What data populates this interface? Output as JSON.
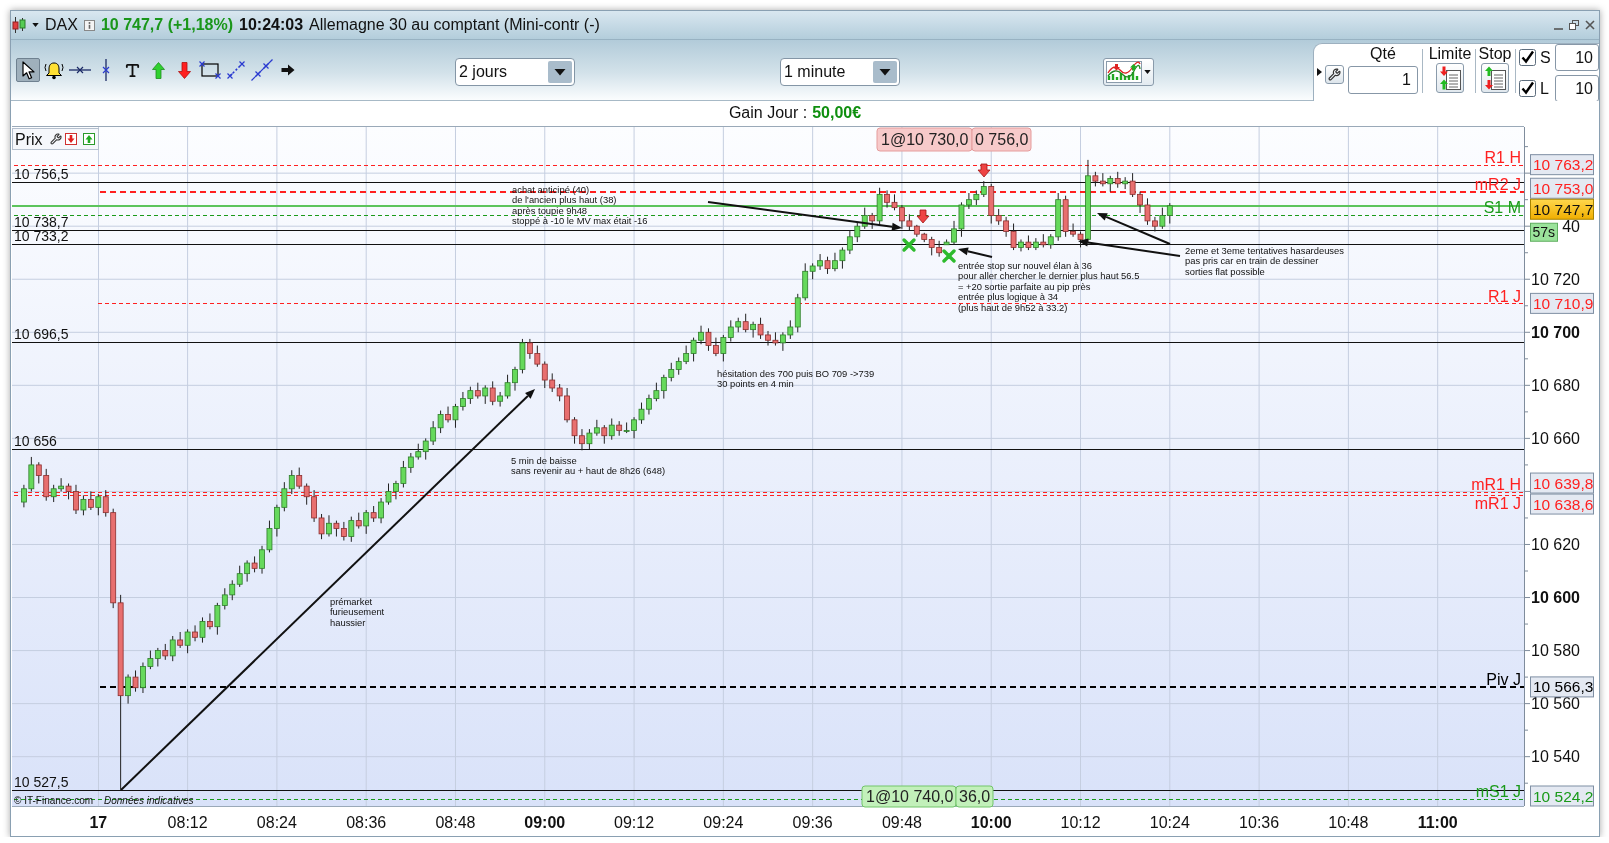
{
  "window": {
    "symbol": "DAX",
    "quote": "10 747,7 (+1,18%)",
    "time": "10:24:03",
    "instrument": "Allemagne 30 au comptant (Mini-contr (-)"
  },
  "toolbar": {
    "tools": [
      {
        "kind": "pointer",
        "selected": true
      },
      {
        "kind": "alert",
        "selected": false
      },
      {
        "kind": "horizontal-line",
        "selected": false
      },
      {
        "kind": "vertical-line",
        "selected": false
      },
      {
        "kind": "text",
        "selected": false
      },
      {
        "kind": "buy-arrow",
        "selected": false
      },
      {
        "kind": "sell-arrow",
        "selected": false
      },
      {
        "kind": "rectangle",
        "selected": false
      },
      {
        "kind": "dotted-segment",
        "selected": false
      },
      {
        "kind": "trend-line",
        "selected": false
      },
      {
        "kind": "arrow",
        "selected": false
      }
    ],
    "period": "2 jours",
    "interval": "1 minute"
  },
  "order_panel": {
    "quantity_label": "Qté",
    "quantity": "1",
    "limit_label": "Limite",
    "stop_label": "Stop",
    "offsets": [
      {
        "label": "S",
        "checked": true,
        "value": "10"
      },
      {
        "label": "L",
        "checked": true,
        "value": "10"
      }
    ]
  },
  "gain": {
    "label": "Gain Jour :",
    "value": "50,00€"
  },
  "chart": {
    "legend": "Prix",
    "trades": [
      {
        "kind": "loss",
        "entry": "1@10 730,0",
        "exit": "0 756,0"
      },
      {
        "kind": "profit",
        "entry": "1@10 740,0",
        "exit": "36,0"
      }
    ],
    "notes": [
      {
        "lines": [
          "achat anticipé (40)",
          "de l'ancien plus haut (38)",
          "après toupie 9h48",
          "stoppé à -10 le MV max était -16"
        ]
      },
      {
        "lines": [
          "entrée stop sur nouvel élan à 36",
          "pour aller chercher le dernier plus haut 56.5",
          "= +20 sortie parfaite au pip près",
          "entrée plus logique à 34",
          "(plus haut de 9h52 à 33.2)"
        ]
      },
      {
        "lines": [
          "2eme et 3eme tentatives hasardeuses",
          "pas pris car en train de dessiner",
          "sorties flat possible"
        ]
      },
      {
        "lines": [
          "hésitation des 700 puis BO 709 ->739",
          "30 points en 4 min"
        ]
      },
      {
        "lines": [
          "5 min de baisse",
          "sans revenir au + haut de 8h26 (648)"
        ]
      },
      {
        "lines": [
          "prémarket",
          "furieusement",
          "haussier"
        ]
      }
    ],
    "markers": [
      {
        "kind": "down-arrow"
      },
      {
        "kind": "down-arrow"
      },
      {
        "kind": "cross"
      },
      {
        "kind": "cross"
      }
    ],
    "chart_data": {
      "type": "candlestick",
      "x": [
        470,
        471,
        472,
        473,
        474,
        475,
        476,
        477,
        478,
        479,
        480,
        481,
        482,
        483,
        484,
        485,
        486,
        487,
        488,
        489,
        490,
        491,
        492,
        493,
        494,
        495,
        496,
        497,
        498,
        499,
        500,
        501,
        502,
        503,
        504,
        505,
        506,
        507,
        508,
        509,
        510,
        511,
        512,
        513,
        514,
        515,
        516,
        517,
        518,
        519,
        520,
        521,
        522,
        523,
        524,
        525,
        526,
        527,
        528,
        529,
        530,
        531,
        532,
        533,
        534,
        535,
        536,
        537,
        538,
        539,
        540,
        541,
        542,
        543,
        544,
        545,
        546,
        547,
        548,
        549,
        550,
        551,
        552,
        553,
        554,
        555,
        556,
        557,
        558,
        559,
        560,
        561,
        562,
        563,
        564,
        565,
        566,
        567,
        568,
        569,
        570,
        571,
        572,
        573,
        574,
        575,
        576,
        577,
        578,
        579,
        580,
        581,
        582,
        583,
        584,
        585,
        586,
        587,
        588,
        589,
        590,
        591,
        592,
        593,
        594,
        595,
        596,
        597,
        598,
        599,
        600,
        601,
        602,
        603,
        604,
        605,
        606,
        607,
        608,
        609,
        610,
        611,
        612,
        613,
        614,
        615,
        616,
        617,
        618,
        619,
        620,
        621,
        622,
        623,
        624
      ],
      "ohlc": [
        [
          10636,
          10642.5,
          10634,
          10641
        ],
        [
          10641,
          10653,
          10640,
          10650
        ],
        [
          10650,
          10651,
          10643,
          10646
        ],
        [
          10646,
          10648.5,
          10636.5,
          10638
        ],
        [
          10638,
          10642.5,
          10636,
          10641
        ],
        [
          10641,
          10645,
          10640,
          10642
        ],
        [
          10642,
          10643,
          10637,
          10640
        ],
        [
          10640,
          10642.5,
          10631.5,
          10633
        ],
        [
          10633,
          10638.5,
          10631,
          10637
        ],
        [
          10637,
          10640,
          10633,
          10634
        ],
        [
          10634,
          10639,
          10631,
          10638
        ],
        [
          10638,
          10640.5,
          10630.5,
          10632
        ],
        [
          10632,
          10633.5,
          10596,
          10598
        ],
        [
          10598,
          10601,
          10527.5,
          10563
        ],
        [
          10563,
          10571,
          10560,
          10570
        ],
        [
          10570,
          10572.5,
          10564.5,
          10566
        ],
        [
          10566,
          10575.5,
          10564,
          10574
        ],
        [
          10574,
          10580,
          10573,
          10577
        ],
        [
          10577,
          10581,
          10574,
          10580
        ],
        [
          10580,
          10582.5,
          10576.5,
          10578
        ],
        [
          10578,
          10585.5,
          10576,
          10584
        ],
        [
          10584,
          10587,
          10581,
          10582
        ],
        [
          10582,
          10588,
          10579,
          10587
        ],
        [
          10587,
          10589.5,
          10583.5,
          10585
        ],
        [
          10585,
          10592.5,
          10583,
          10591
        ],
        [
          10591,
          10594,
          10588,
          10589
        ],
        [
          10589,
          10598,
          10586,
          10597
        ],
        [
          10597,
          10603.5,
          10595.5,
          10601
        ],
        [
          10601,
          10606.5,
          10599,
          10605
        ],
        [
          10605,
          10612,
          10604,
          10609
        ],
        [
          10609,
          10614,
          10606,
          10613
        ],
        [
          10613,
          10615.5,
          10609.5,
          10611
        ],
        [
          10611,
          10619.5,
          10609,
          10618
        ],
        [
          10618,
          10629,
          10617,
          10626
        ],
        [
          10626,
          10635,
          10623,
          10634
        ],
        [
          10634,
          10643.5,
          10632.5,
          10641
        ],
        [
          10641,
          10648,
          10639,
          10646
        ],
        [
          10646,
          10649,
          10641,
          10642
        ],
        [
          10642,
          10643,
          10635,
          10638
        ],
        [
          10638,
          10640.5,
          10628.5,
          10630
        ],
        [
          10630,
          10631.5,
          10622,
          10624
        ],
        [
          10624,
          10631,
          10623,
          10628
        ],
        [
          10628,
          10629,
          10623,
          10626
        ],
        [
          10626,
          10628.5,
          10621.5,
          10623
        ],
        [
          10623,
          10630.5,
          10621,
          10629
        ],
        [
          10629,
          10632,
          10626,
          10627
        ],
        [
          10627,
          10633,
          10624,
          10632
        ],
        [
          10632,
          10634.5,
          10628.5,
          10630
        ],
        [
          10630,
          10637.5,
          10628,
          10636
        ],
        [
          10636,
          10643,
          10635,
          10640
        ],
        [
          10640,
          10644,
          10637,
          10643
        ],
        [
          10643,
          10651.5,
          10641.5,
          10649
        ],
        [
          10649,
          10654.5,
          10647,
          10653
        ],
        [
          10653,
          10658,
          10652,
          10655
        ],
        [
          10655,
          10660,
          10652,
          10659
        ],
        [
          10659,
          10666.5,
          10657.5,
          10664
        ],
        [
          10664,
          10670.5,
          10662,
          10669
        ],
        [
          10669,
          10672,
          10666,
          10667
        ],
        [
          10667,
          10673,
          10664,
          10672
        ],
        [
          10672,
          10677.5,
          10670.5,
          10675
        ],
        [
          10675,
          10679.5,
          10673,
          10678
        ],
        [
          10678,
          10681,
          10675,
          10676
        ],
        [
          10676,
          10680,
          10673,
          10679
        ],
        [
          10679,
          10681.5,
          10672.5,
          10674
        ],
        [
          10674,
          10677.5,
          10672,
          10676
        ],
        [
          10676,
          10684,
          10675,
          10681
        ],
        [
          10681,
          10687,
          10678,
          10686
        ],
        [
          10686,
          10697.5,
          10684.5,
          10696
        ],
        [
          10696,
          10697.5,
          10690,
          10692
        ],
        [
          10692,
          10695,
          10687,
          10688
        ],
        [
          10688,
          10689,
          10679,
          10682
        ],
        [
          10682,
          10684.5,
          10677.5,
          10679
        ],
        [
          10679,
          10680.5,
          10674,
          10676
        ],
        [
          10676,
          10679,
          10666,
          10667
        ],
        [
          10667,
          10668,
          10658,
          10661
        ],
        [
          10661,
          10663.5,
          10655.5,
          10658
        ],
        [
          10658,
          10663.5,
          10656,
          10662
        ],
        [
          10662,
          10667,
          10661,
          10664
        ],
        [
          10664,
          10665,
          10658,
          10661
        ],
        [
          10661,
          10667.5,
          10659.5,
          10665
        ],
        [
          10665,
          10666.5,
          10661,
          10663
        ],
        [
          10663,
          10666,
          10662,
          10663
        ],
        [
          10663,
          10668,
          10660,
          10667
        ],
        [
          10667,
          10673.5,
          10665.5,
          10671
        ],
        [
          10671,
          10676.5,
          10669,
          10675
        ],
        [
          10675,
          10681,
          10674,
          10678
        ],
        [
          10678,
          10684,
          10675,
          10683
        ],
        [
          10683,
          10688.5,
          10681.5,
          10686
        ],
        [
          10686,
          10690.5,
          10684,
          10689
        ],
        [
          10689,
          10695,
          10688,
          10692
        ],
        [
          10692,
          10698,
          10689,
          10697
        ],
        [
          10697,
          10702.5,
          10695.5,
          10700
        ],
        [
          10700,
          10701.5,
          10693,
          10695
        ],
        [
          10695,
          10698,
          10691,
          10692
        ],
        [
          10692,
          10699,
          10689,
          10698
        ],
        [
          10698,
          10704.5,
          10696.5,
          10702
        ],
        [
          10702,
          10705.5,
          10700,
          10704
        ],
        [
          10704,
          10707,
          10700,
          10701
        ],
        [
          10701,
          10704,
          10698,
          10703
        ],
        [
          10703,
          10705.5,
          10697.5,
          10699
        ],
        [
          10699,
          10700.5,
          10695,
          10697
        ],
        [
          10697,
          10700,
          10695,
          10696
        ],
        [
          10696,
          10700,
          10693,
          10699
        ],
        [
          10699,
          10704.5,
          10697.5,
          10702
        ],
        [
          10702,
          10714.5,
          10700,
          10713
        ],
        [
          10713,
          10726,
          10712,
          10723
        ],
        [
          10723,
          10726,
          10720,
          10725
        ],
        [
          10725,
          10729.5,
          10723.5,
          10727
        ],
        [
          10727,
          10728.5,
          10722,
          10724
        ],
        [
          10724,
          10730,
          10723,
          10727
        ],
        [
          10727,
          10732,
          10724,
          10731
        ],
        [
          10731,
          10738.5,
          10729.5,
          10736
        ],
        [
          10736,
          10741.5,
          10734,
          10740
        ],
        [
          10740,
          10747,
          10739,
          10744
        ],
        [
          10744,
          10745,
          10739,
          10742
        ],
        [
          10742,
          10754.5,
          10740.5,
          10752
        ],
        [
          10752,
          10753.5,
          10747,
          10749
        ],
        [
          10749,
          10752,
          10746,
          10747
        ],
        [
          10747,
          10748,
          10739,
          10742
        ],
        [
          10742,
          10744.5,
          10738.5,
          10740
        ],
        [
          10740,
          10740.5,
          10736,
          10737
        ],
        [
          10737,
          10737.5,
          10734,
          10735
        ],
        [
          10735,
          10736,
          10729,
          10732
        ],
        [
          10732,
          10734.5,
          10728.5,
          10730
        ],
        [
          10733,
          10735,
          10733,
          10734
        ],
        [
          10734,
          10742,
          10733,
          10739
        ],
        [
          10739,
          10749,
          10736,
          10748
        ],
        [
          10748,
          10752.5,
          10746.5,
          10750
        ],
        [
          10750,
          10753.5,
          10748,
          10752
        ],
        [
          10752,
          10757,
          10751,
          10755
        ],
        [
          10755,
          10756,
          10741,
          10744
        ],
        [
          10744,
          10746.5,
          10740.5,
          10742
        ],
        [
          10742,
          10743.5,
          10736,
          10738
        ],
        [
          10738,
          10741,
          10731,
          10732
        ],
        [
          10732,
          10735,
          10730.5,
          10734
        ],
        [
          10734,
          10736.5,
          10731,
          10732
        ],
        [
          10732,
          10735.5,
          10731,
          10734
        ],
        [
          10734,
          10737,
          10732,
          10733
        ],
        [
          10733,
          10737,
          10731.5,
          10736
        ],
        [
          10736,
          10752.5,
          10734.5,
          10750
        ],
        [
          10750,
          10751.5,
          10736,
          10738
        ],
        [
          10738,
          10741,
          10736,
          10737
        ],
        [
          10737,
          10738,
          10732,
          10735
        ],
        [
          10735,
          10765,
          10733.5,
          10759
        ],
        [
          10759,
          10760.5,
          10755,
          10757
        ],
        [
          10757,
          10760,
          10755,
          10756
        ],
        [
          10756,
          10759,
          10753,
          10758
        ],
        [
          10758,
          10760.5,
          10754.5,
          10756
        ],
        [
          10756,
          10758.5,
          10754,
          10757
        ],
        [
          10757,
          10760,
          10751,
          10752
        ],
        [
          10752,
          10753,
          10745,
          10748
        ],
        [
          10748,
          10750.5,
          10740.5,
          10742
        ],
        [
          10742,
          10743.5,
          10738,
          10740
        ],
        [
          10740,
          10747,
          10739,
          10744
        ],
        [
          10744,
          10748.7,
          10741,
          10747.7
        ]
      ],
      "xlim": [
        468.4,
        671.6
      ],
      "ylim": [
        10521.4,
        10777.4
      ],
      "grid": true,
      "xticks": [
        {
          "value": 492,
          "label": "08:12"
        },
        {
          "value": 504,
          "label": "08:24"
        },
        {
          "value": 516,
          "label": "08:36"
        },
        {
          "value": 528,
          "label": "08:48"
        },
        {
          "value": 540,
          "label": "09:00"
        },
        {
          "value": 552,
          "label": "09:12"
        },
        {
          "value": 564,
          "label": "09:24"
        },
        {
          "value": 576,
          "label": "09:36"
        },
        {
          "value": 588,
          "label": "09:48"
        },
        {
          "value": 600,
          "label": "10:00"
        },
        {
          "value": 612,
          "label": "10:12"
        },
        {
          "value": 624,
          "label": "10:24"
        },
        {
          "value": 636,
          "label": "10:36"
        },
        {
          "value": 648,
          "label": "10:48"
        },
        {
          "value": 660,
          "label": "11:00"
        }
      ],
      "yticks": [
        {
          "value": 10720,
          "label": "10 720"
        },
        {
          "value": 10700,
          "label": "10 700"
        },
        {
          "value": 10680,
          "label": "10 680"
        },
        {
          "value": 10660,
          "label": "10 660"
        },
        {
          "value": 10620,
          "label": "10 620"
        },
        {
          "value": 10600,
          "label": "10 600"
        },
        {
          "value": 10580,
          "label": "10 580"
        },
        {
          "value": 10560,
          "label": "10 560"
        },
        {
          "value": 10540,
          "label": "10 540"
        }
      ],
      "ref_lines": [
        {
          "axis": "y",
          "value": 10763.2,
          "label": "R1 H",
          "color": "#ff2020"
        },
        {
          "axis": "y",
          "value": 10756.5,
          "label": "10 756,5",
          "color": "#111111"
        },
        {
          "axis": "y",
          "value": 10753.0,
          "label": "mR2 J",
          "color": "#ff2020"
        },
        {
          "axis": "y",
          "value": 10747.7,
          "color": "#5cc45c"
        },
        {
          "axis": "y",
          "value": 10744.4,
          "label": "S1 M",
          "color": "#1a9a1a"
        },
        {
          "axis": "y",
          "value": 10738.7,
          "label": "10 738,7",
          "color": "#111111"
        },
        {
          "axis": "y",
          "value": 10733.2,
          "label": "10 733,2",
          "color": "#111111"
        },
        {
          "axis": "y",
          "value": 10710.9,
          "label": "R1 J",
          "color": "#ff2020"
        },
        {
          "axis": "y",
          "value": 10696.5,
          "label": "10 696,5",
          "color": "#111111"
        },
        {
          "axis": "y",
          "value": 10656,
          "label": "10 656",
          "color": "#111111"
        },
        {
          "axis": "y",
          "value": 10639.8,
          "label": "mR1 H",
          "color": "#ff2020"
        },
        {
          "axis": "y",
          "value": 10638.6,
          "label": "mR1 J",
          "color": "#ff2020"
        },
        {
          "axis": "y",
          "value": 10566.3,
          "label": "Piv J",
          "color": "#000000"
        },
        {
          "axis": "y",
          "value": 10527.5,
          "label": "10 527,5",
          "color": "#111111"
        },
        {
          "axis": "y",
          "value": 10524.2,
          "label": "mS1 J",
          "color": "#1a9a1a"
        }
      ]
    },
    "price_tags": [
      {
        "kind": "level",
        "text": "10 763,2"
      },
      {
        "kind": "level",
        "text": "10 753,0"
      },
      {
        "kind": "last-price",
        "text": "10 747,7"
      },
      {
        "kind": "level",
        "text": "10 710,9"
      },
      {
        "kind": "level",
        "text": "10 639,8"
      },
      {
        "kind": "level",
        "text": "10 638,6"
      },
      {
        "kind": "level",
        "text": "10 566,3"
      },
      {
        "kind": "level",
        "text": "10 524,2"
      }
    ],
    "countdown": "57s",
    "session_date": "17",
    "covered_tick_label": "40",
    "copyright": "© IT-Finance.com",
    "disclaimer": "Données indicatives"
  }
}
